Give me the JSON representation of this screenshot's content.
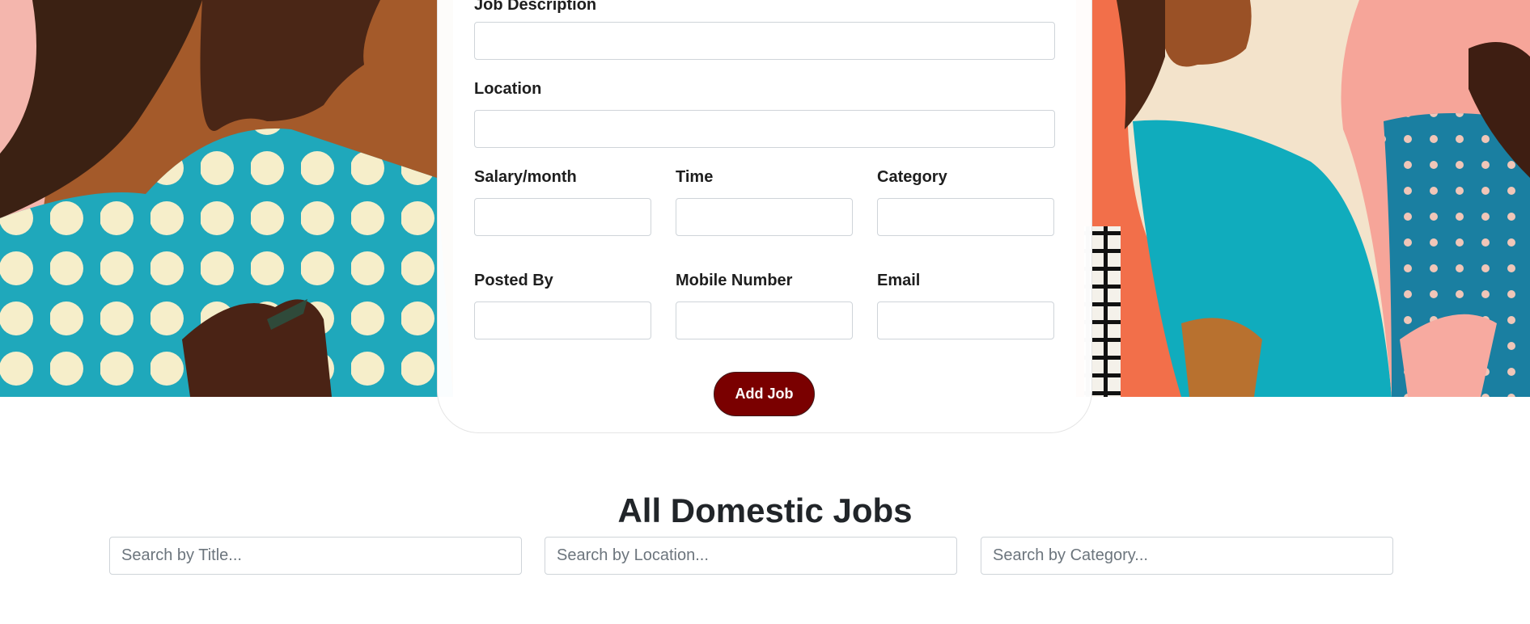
{
  "form": {
    "job_description_label": "Job Description",
    "location_label": "Location",
    "salary_label": "Salary/month",
    "time_label": "Time",
    "category_label": "Category",
    "posted_by_label": "Posted By",
    "mobile_label": "Mobile Number",
    "email_label": "Email",
    "job_description_value": "",
    "location_value": "",
    "salary_value": "",
    "time_value": "",
    "category_value": "",
    "posted_by_value": "",
    "mobile_value": "",
    "email_value": "",
    "submit_label": "Add Job"
  },
  "jobs_section": {
    "title": "All Domestic Jobs",
    "search_title_placeholder": "Search by Title...",
    "search_location_placeholder": "Search by Location...",
    "search_category_placeholder": "Search by Category..."
  },
  "colors": {
    "submit_button": "#7a0000",
    "hero_teal": "#1aa9bd",
    "hero_coral": "#f5724e",
    "hero_brown": "#3d1f12"
  }
}
